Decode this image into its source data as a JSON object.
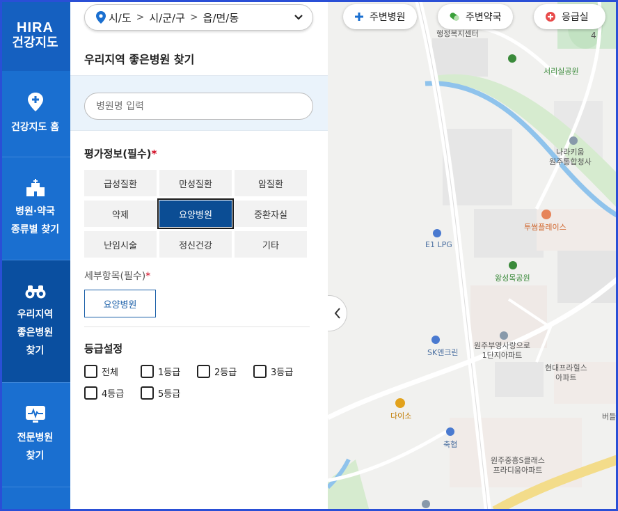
{
  "nav": {
    "logo_line1": "HIRA",
    "logo_line2": "건강지도",
    "items": [
      {
        "label": "건강지도 홈",
        "icon": "map-pin-icon"
      },
      {
        "label": "병원·약국\n종류별 찾기",
        "icon": "hospital-building-icon"
      },
      {
        "label": "우리지역\n좋은병원\n찾기",
        "icon": "binoculars-icon",
        "active": true
      },
      {
        "label": "전문병원\n찾기",
        "icon": "heart-monitor-icon"
      }
    ]
  },
  "region": {
    "sido": "시/도",
    "sigungu": "시/군/구",
    "dong": "읍/면/동"
  },
  "panel": {
    "title": "우리지역 좋은병원 찾기",
    "search_placeholder": "병원명 입력",
    "eval_title": "평가정보(필수)",
    "required_mark": "*",
    "categories": [
      "급성질환",
      "만성질환",
      "암질환",
      "약제",
      "요양병원",
      "중환자실",
      "난임시술",
      "정신건강",
      "기타"
    ],
    "active_category": "요양병원",
    "sub_title": "세부항목(필수)",
    "sub_item": "요양병원",
    "grade_title": "등급설정",
    "grades": [
      "전체",
      "1등급",
      "2등급",
      "3등급",
      "4등급",
      "5등급"
    ]
  },
  "map": {
    "pills": [
      {
        "label": "주변병원",
        "icon": "plus-icon"
      },
      {
        "label": "주변약국",
        "icon": "pill-icon"
      },
      {
        "label": "응급실",
        "icon": "emergency-icon"
      }
    ],
    "labels": [
      "행정복지센터",
      "서리실공원",
      "4",
      "나라키움\n원주통합청사",
      "투썸플레이스",
      "E1 LPG",
      "왕성목공원",
      "원주부영사랑으로\n1단지아파트",
      "현대프라힐스\n아파트",
      "SK엔크린",
      "다이소",
      "축협",
      "원주중흥S클래스\n프라디움아파트",
      "버들"
    ]
  },
  "colors": {
    "nav": "#1a6fd0",
    "nav_active": "#0a4fa0",
    "accent": "#0b4d94",
    "required": "#d0021b"
  }
}
